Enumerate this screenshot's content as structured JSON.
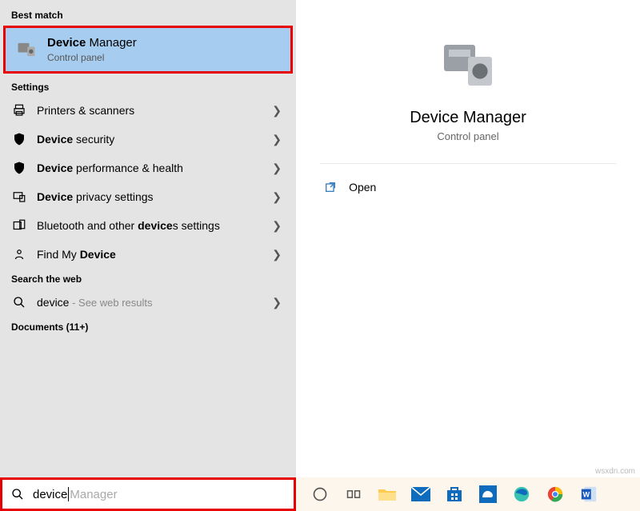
{
  "sections": {
    "best_match_header": "Best match",
    "settings_header": "Settings",
    "web_header": "Search the web",
    "documents_header": "Documents (11+)"
  },
  "best_match": {
    "title_bold": "Device",
    "title_rest": " Manager",
    "subtitle": "Control panel"
  },
  "settings_items": [
    {
      "icon": "printer",
      "pre": "",
      "bold": "",
      "mid": "Printers & scanners",
      "post": ""
    },
    {
      "icon": "shield",
      "pre": "",
      "bold": "Device",
      "mid": " security",
      "post": ""
    },
    {
      "icon": "shield",
      "pre": "",
      "bold": "Device",
      "mid": " performance & health",
      "post": ""
    },
    {
      "icon": "privacy",
      "pre": "",
      "bold": "Device",
      "mid": " privacy settings",
      "post": ""
    },
    {
      "icon": "bluetooth",
      "pre": "Bluetooth and other ",
      "bold": "device",
      "mid": "s settings",
      "post": ""
    },
    {
      "icon": "findmy",
      "pre": "Find My ",
      "bold": "Device",
      "mid": "",
      "post": ""
    }
  ],
  "web_item": {
    "icon": "search",
    "label": "device",
    "suffix": " - See web results"
  },
  "hero": {
    "title": "Device Manager",
    "subtitle": "Control panel"
  },
  "actions": {
    "open": "Open"
  },
  "search": {
    "typed": "device",
    "ghost": " Manager"
  },
  "taskbar_icons": [
    "cortana",
    "taskview",
    "explorer",
    "mail",
    "store",
    "msn",
    "edge",
    "chrome",
    "word"
  ],
  "watermark": "wsxdn.com"
}
